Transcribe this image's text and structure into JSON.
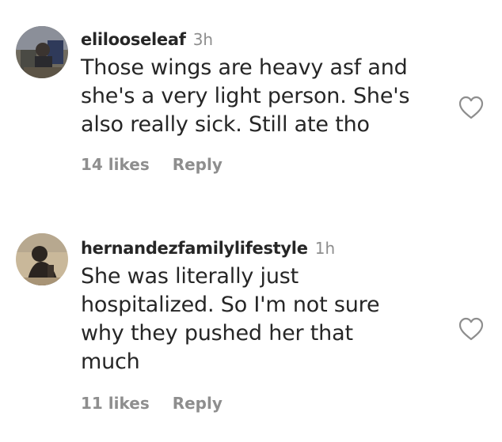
{
  "comments": [
    {
      "username": "elilooseleaf",
      "time": "3h",
      "lines": [
        "Those wings are heavy asf and",
        "she's a very light person. She's",
        "also really sick. Still ate tho"
      ],
      "likes": "14 likes",
      "reply_label": "Reply",
      "avatar_icon": "user-avatar",
      "like_icon": "heart-outline-icon"
    },
    {
      "username": "hernandezfamilylifestyle",
      "time": "1h",
      "lines": [
        "She was literally just",
        "hospitalized. So I'm not sure",
        "why they pushed her that",
        "much"
      ],
      "likes": "11 likes",
      "reply_label": "Reply",
      "avatar_icon": "user-avatar",
      "like_icon": "heart-outline-icon"
    }
  ],
  "colors": {
    "text": "#262626",
    "secondary": "#8e8e8e",
    "background": "#ffffff"
  }
}
